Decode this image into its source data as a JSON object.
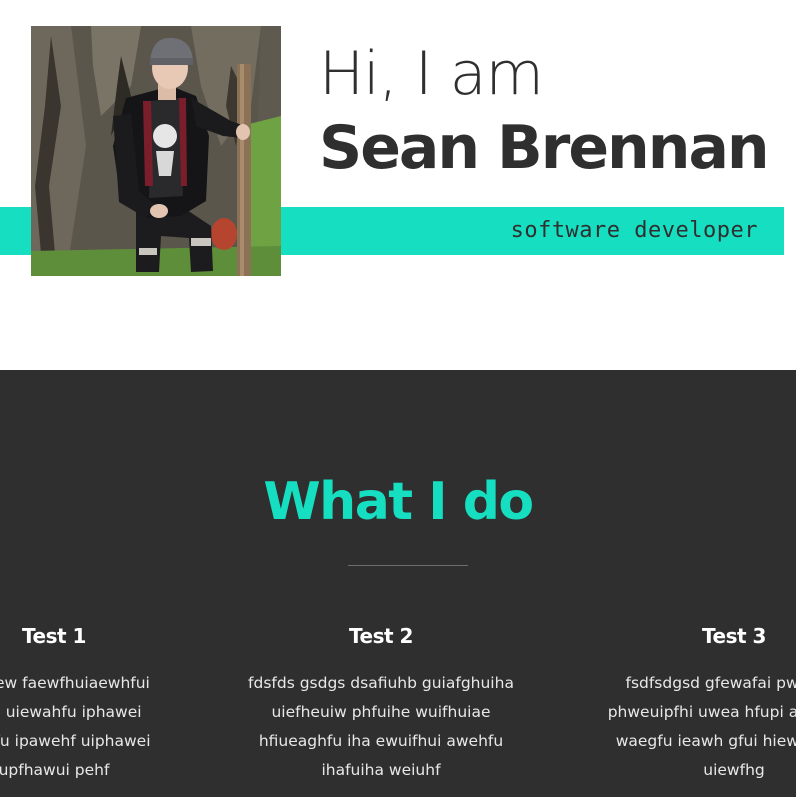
{
  "hero": {
    "greeting": "Hi, I am",
    "name": "Sean Brennan",
    "role": "software developer",
    "photo_alt": "Sean Brennan sitting in a hollow tree trunk holding a wooden staff",
    "accent_color": "#16dfc1"
  },
  "services": {
    "title": "What I do",
    "background": "#2f2f2f",
    "items": [
      {
        "title": "Test 1",
        "text": "sadaew faewfhuiaewhfui\ni pfh uiewahfu iphawei\nw ehfu ipawehf uiphawei\nupfhawui pehf"
      },
      {
        "title": "Test 2",
        "text": "fdsfds gsdgs dsafiuhb guiafghuiha\nuiefheuiw phfuihe wuifhuiae\nhfiueaghfu iha ewuifhui awehfu\nihafuiha weiuhf"
      },
      {
        "title": "Test 3",
        "text": "fsdfsdgsd gfewafai pweh fui\nphweuipfhi uwea hfupi awhef pu\nwaegfu ieawh gfui hiewha fuia\nuiewfhg"
      }
    ]
  }
}
